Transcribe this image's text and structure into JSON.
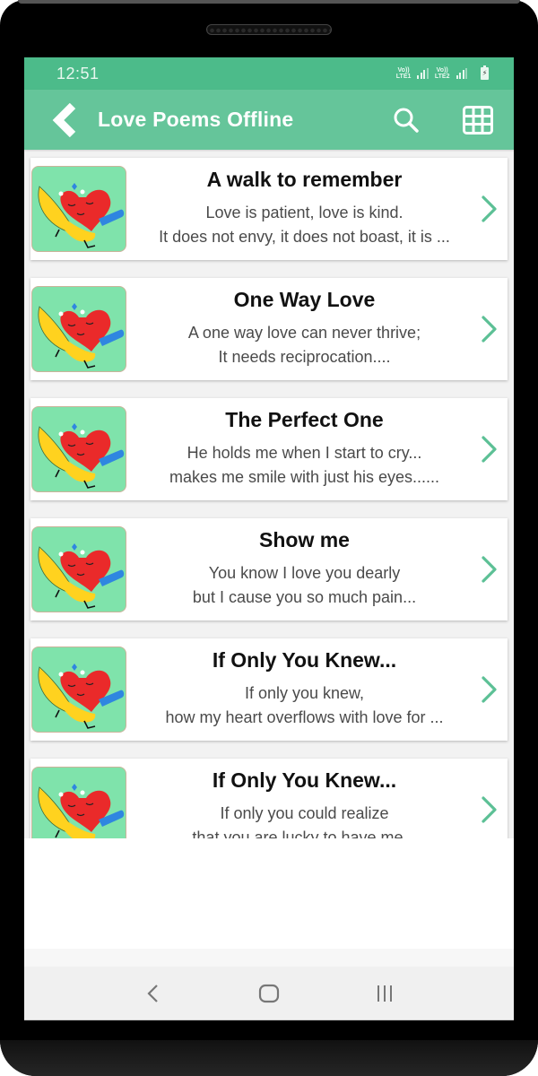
{
  "status_bar": {
    "time": "12:51",
    "sim1": {
      "line1": "Vo))",
      "line2": "LTE1"
    },
    "sim2": {
      "line1": "Vo))",
      "line2": "LTE2"
    },
    "battery_glyph": "⚡"
  },
  "app_bar": {
    "title": "Love Poems Offline",
    "back_icon": "chevron-left-icon",
    "search_icon": "search-icon",
    "grid_icon": "grid-icon"
  },
  "colors": {
    "status_bar": "#4cbb8a",
    "app_bar": "#65c59a",
    "accent": "#5cc095",
    "thumb_bg": "#7fe3ab"
  },
  "poems": [
    {
      "title": "A walk to remember",
      "line1": "Love is patient, love is kind.",
      "line2": "It does not envy, it does not boast, it is ..."
    },
    {
      "title": "One Way Love",
      "line1": "A one way love can never thrive;",
      "line2": "It needs reciprocation...."
    },
    {
      "title": "The Perfect One",
      "line1": "He holds me when I start to cry...",
      "line2": "makes me smile with just his eyes......"
    },
    {
      "title": "Show me",
      "line1": "You know I love you dearly",
      "line2": "but I cause you so much pain..."
    },
    {
      "title": "If Only You Knew...",
      "line1": "If only you knew,",
      "line2": "how my heart overflows with love for ..."
    },
    {
      "title": "If Only You Knew...",
      "line1": "If only you could realize",
      "line2": "that you are lucky to have me..."
    }
  ],
  "nav_bar": {
    "back": "back-icon",
    "home": "home-icon",
    "recents": "recents-icon"
  }
}
